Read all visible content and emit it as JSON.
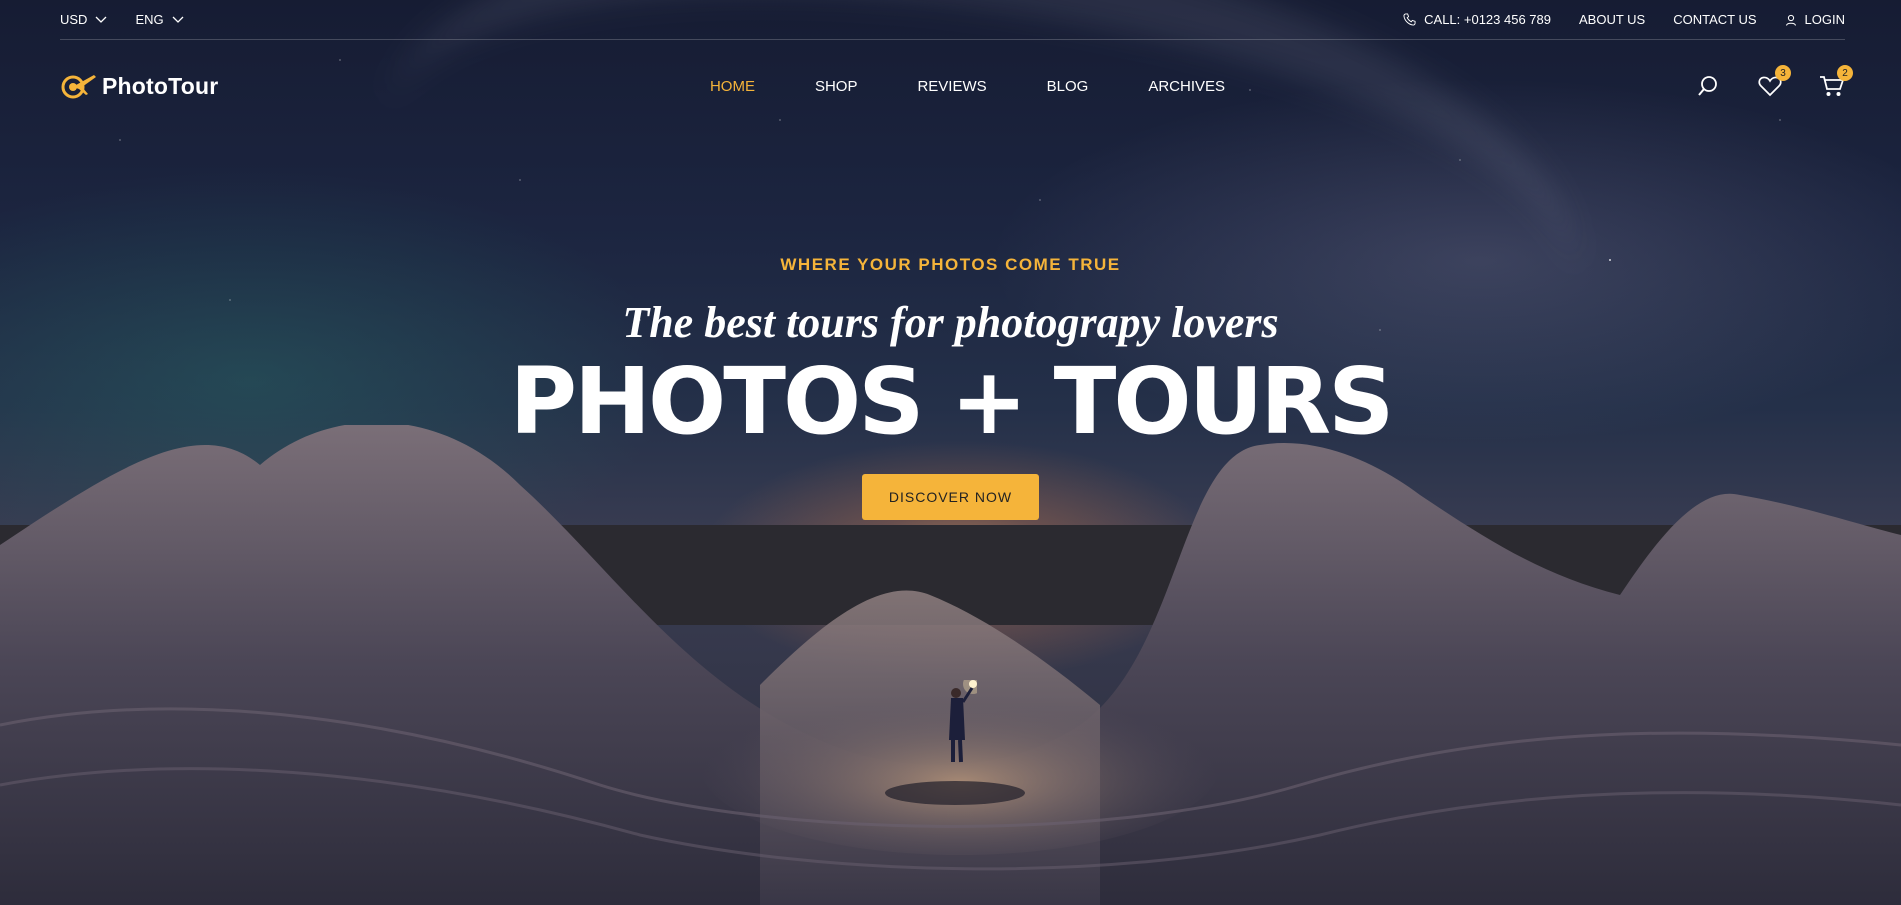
{
  "topbar": {
    "currency": "USD",
    "language": "ENG",
    "call": "CALL: +0123 456 789",
    "about": "ABOUT US",
    "contact": "CONTACT US",
    "login": "LOGIN"
  },
  "brand": {
    "name": "PhotoTour",
    "accent": "#f5b43a"
  },
  "nav": {
    "items": [
      {
        "label": "HOME",
        "active": true
      },
      {
        "label": "SHOP"
      },
      {
        "label": "REVIEWS"
      },
      {
        "label": "BLOG"
      },
      {
        "label": "ARCHIVES"
      }
    ]
  },
  "header_icons": {
    "search": "search-icon",
    "wishlist": {
      "icon": "heart-icon",
      "count": "3"
    },
    "cart": {
      "icon": "cart-icon",
      "count": "2"
    }
  },
  "hero": {
    "tagline": "WHERE YOUR PHOTOS COME TRUE",
    "subtitle": "The best tours for photograpy lovers",
    "headline": "PHOTOS + TOURS",
    "cta": "DISCOVER NOW"
  }
}
